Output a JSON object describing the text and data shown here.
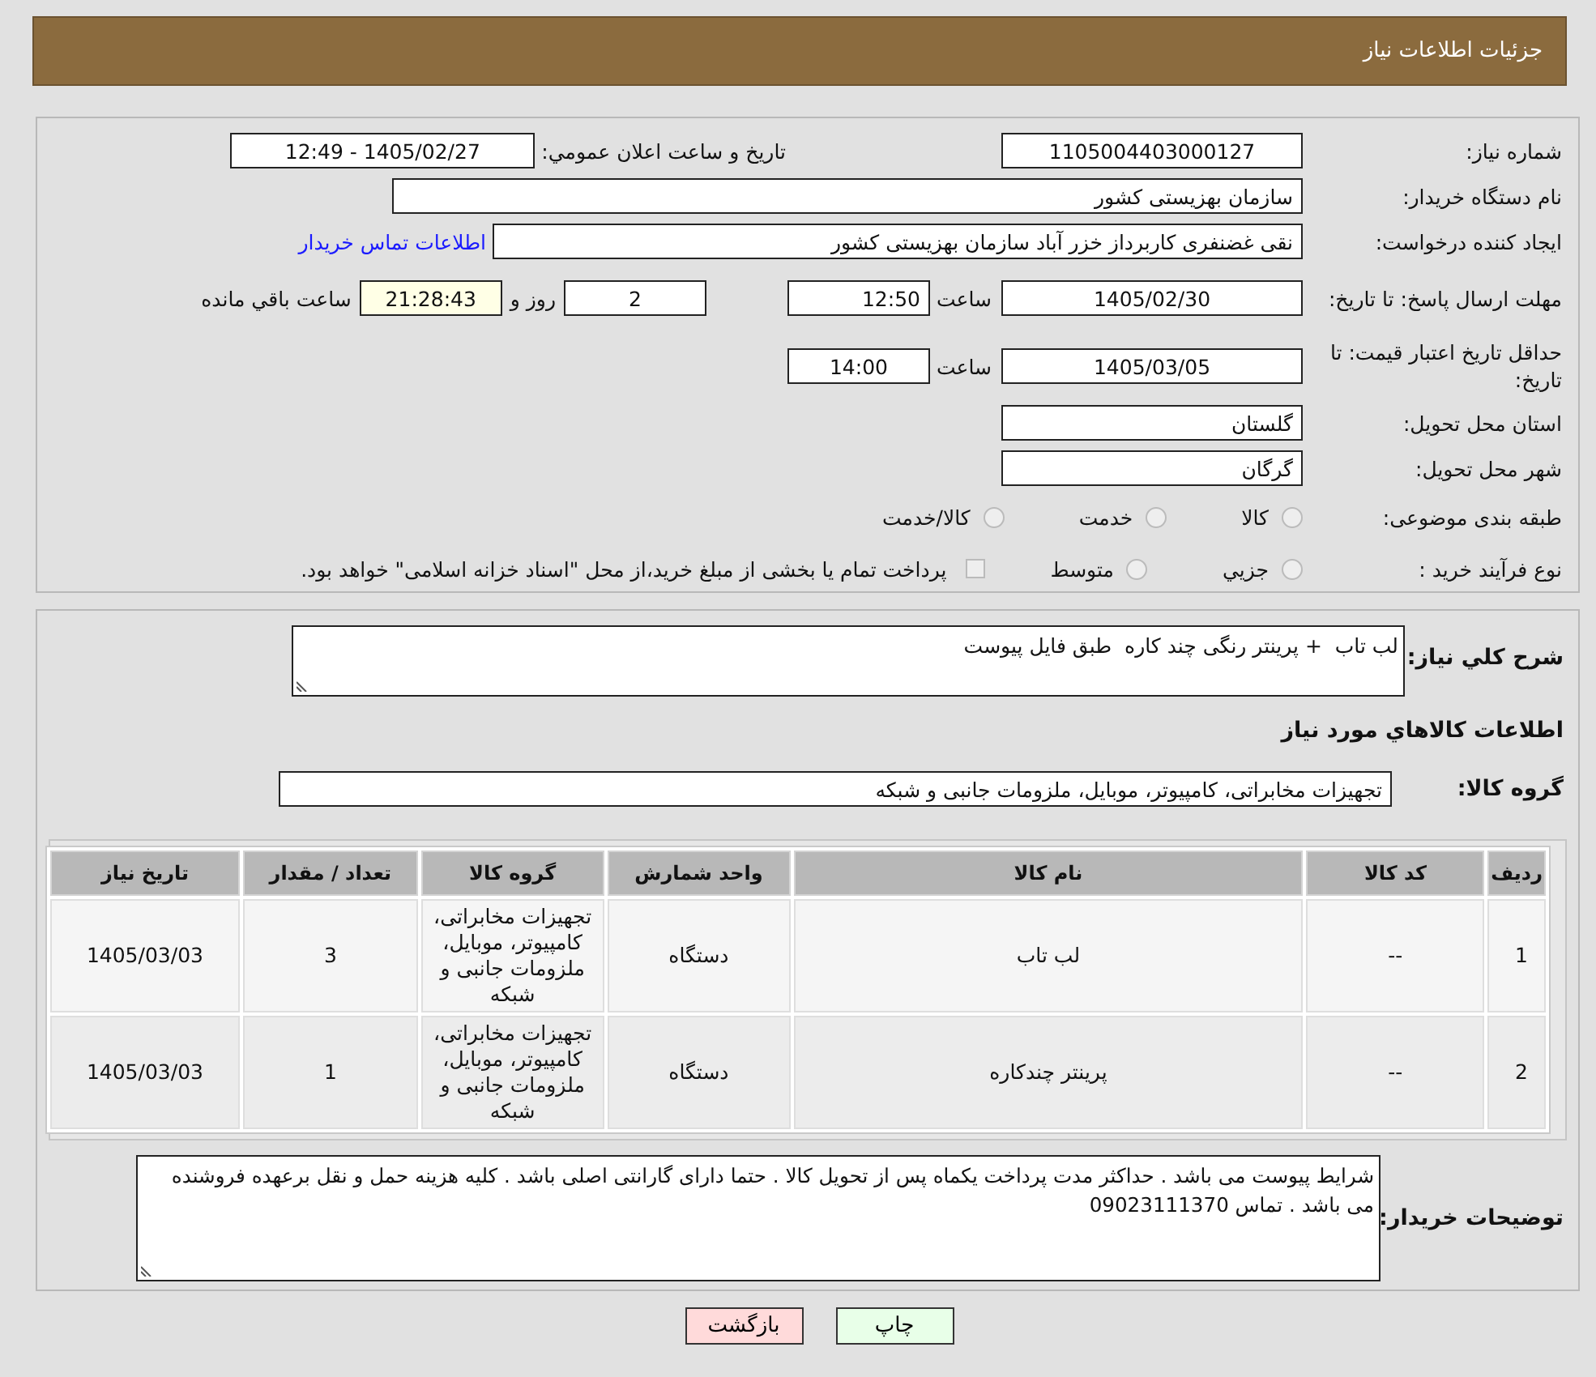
{
  "header": {
    "title": "جزئیات اطلاعات نیاز"
  },
  "need_number": {
    "label": "شماره نیاز:",
    "value": "1105004403000127"
  },
  "announcement": {
    "label": "تاریخ و ساعت اعلان عمومي:",
    "value": "1405/02/27 - 12:49"
  },
  "buyer": {
    "label": "نام دستگاه خریدار:",
    "value": "سازمان بهزیستی کشور"
  },
  "requester": {
    "label": "ایجاد کننده درخواست:",
    "value": "نقی غضنفری کاربرداز خزر آباد سازمان بهزیستی کشور",
    "link": "اطلاعات تماس خریدار"
  },
  "response_deadline": {
    "label": "مهلت ارسال پاسخ: تا تاریخ:",
    "date": "1405/02/30",
    "time_label": "ساعت",
    "time": "12:50",
    "days": "2",
    "days_label": "روز و",
    "remaining": "21:28:43",
    "remaining_label": "ساعت باقي مانده"
  },
  "price_validity": {
    "label": "حداقل تاریخ اعتبار قیمت: تا تاریخ:",
    "date": "1405/03/05",
    "time_label": "ساعت",
    "time": "14:00"
  },
  "province": {
    "label": "استان محل تحویل:",
    "value": "گلستان"
  },
  "city": {
    "label": "شهر محل تحویل:",
    "value": "گرگان"
  },
  "category": {
    "label": "طبقه بندی موضوعی:",
    "options": [
      {
        "label": "کالا",
        "selected": false
      },
      {
        "label": "خدمت",
        "selected": false
      },
      {
        "label": "کالا/خدمت",
        "selected": false
      }
    ]
  },
  "process": {
    "label": "نوع فرآیند خرید :",
    "options": [
      {
        "label": "جزيي",
        "selected": false
      },
      {
        "label": "متوسط",
        "selected": false
      }
    ],
    "treasury": {
      "label": "پرداخت تمام یا بخشی از مبلغ خرید،از محل \"اسناد خزانه اسلامی\" خواهد بود.",
      "checked": false
    }
  },
  "description": {
    "label": "شرح کلي نیاز:",
    "value": "لب تاب  + پرینتر رنگی چند کاره  طبق فایل پیوست"
  },
  "goods_title": "اطلاعات کالاهاي مورد نیاز",
  "goods_group": {
    "label": "گروه کالا:",
    "value": "تجهیزات مخابراتی، کامپیوتر، موبایل، ملزومات جانبی و شبکه"
  },
  "table": {
    "columns": [
      "ردیف",
      "کد کالا",
      "نام کالا",
      "واحد شمارش",
      "گروه کالا",
      "تعداد / مقدار",
      "تاریخ نیاز"
    ],
    "rows": [
      [
        "1",
        "--",
        "لب تاب",
        "دستگاه",
        "تجهیزات مخابراتی، کامپیوتر، موبایل، ملزومات جانبی و شبکه",
        "3",
        "1405/03/03"
      ],
      [
        "2",
        "--",
        "پرینتر چندکاره",
        "دستگاه",
        "تجهیزات مخابراتی، کامپیوتر، موبایل، ملزومات جانبی و شبکه",
        "1",
        "1405/03/03"
      ]
    ]
  },
  "buyer_notes": {
    "label": "توضیحات خریدار:",
    "value": "شرایط پیوست می باشد . حداکثر مدت پرداخت یکماه پس از تحویل کالا . حتما دارای گارانتی اصلی باشد  . کلیه هزینه حمل و نقل برعهده فروشنده می باشد . تماس 09023111370"
  },
  "buttons": [
    {
      "label": "چاپ",
      "kind": "print"
    },
    {
      "label": "بازگشت",
      "kind": "back"
    }
  ]
}
